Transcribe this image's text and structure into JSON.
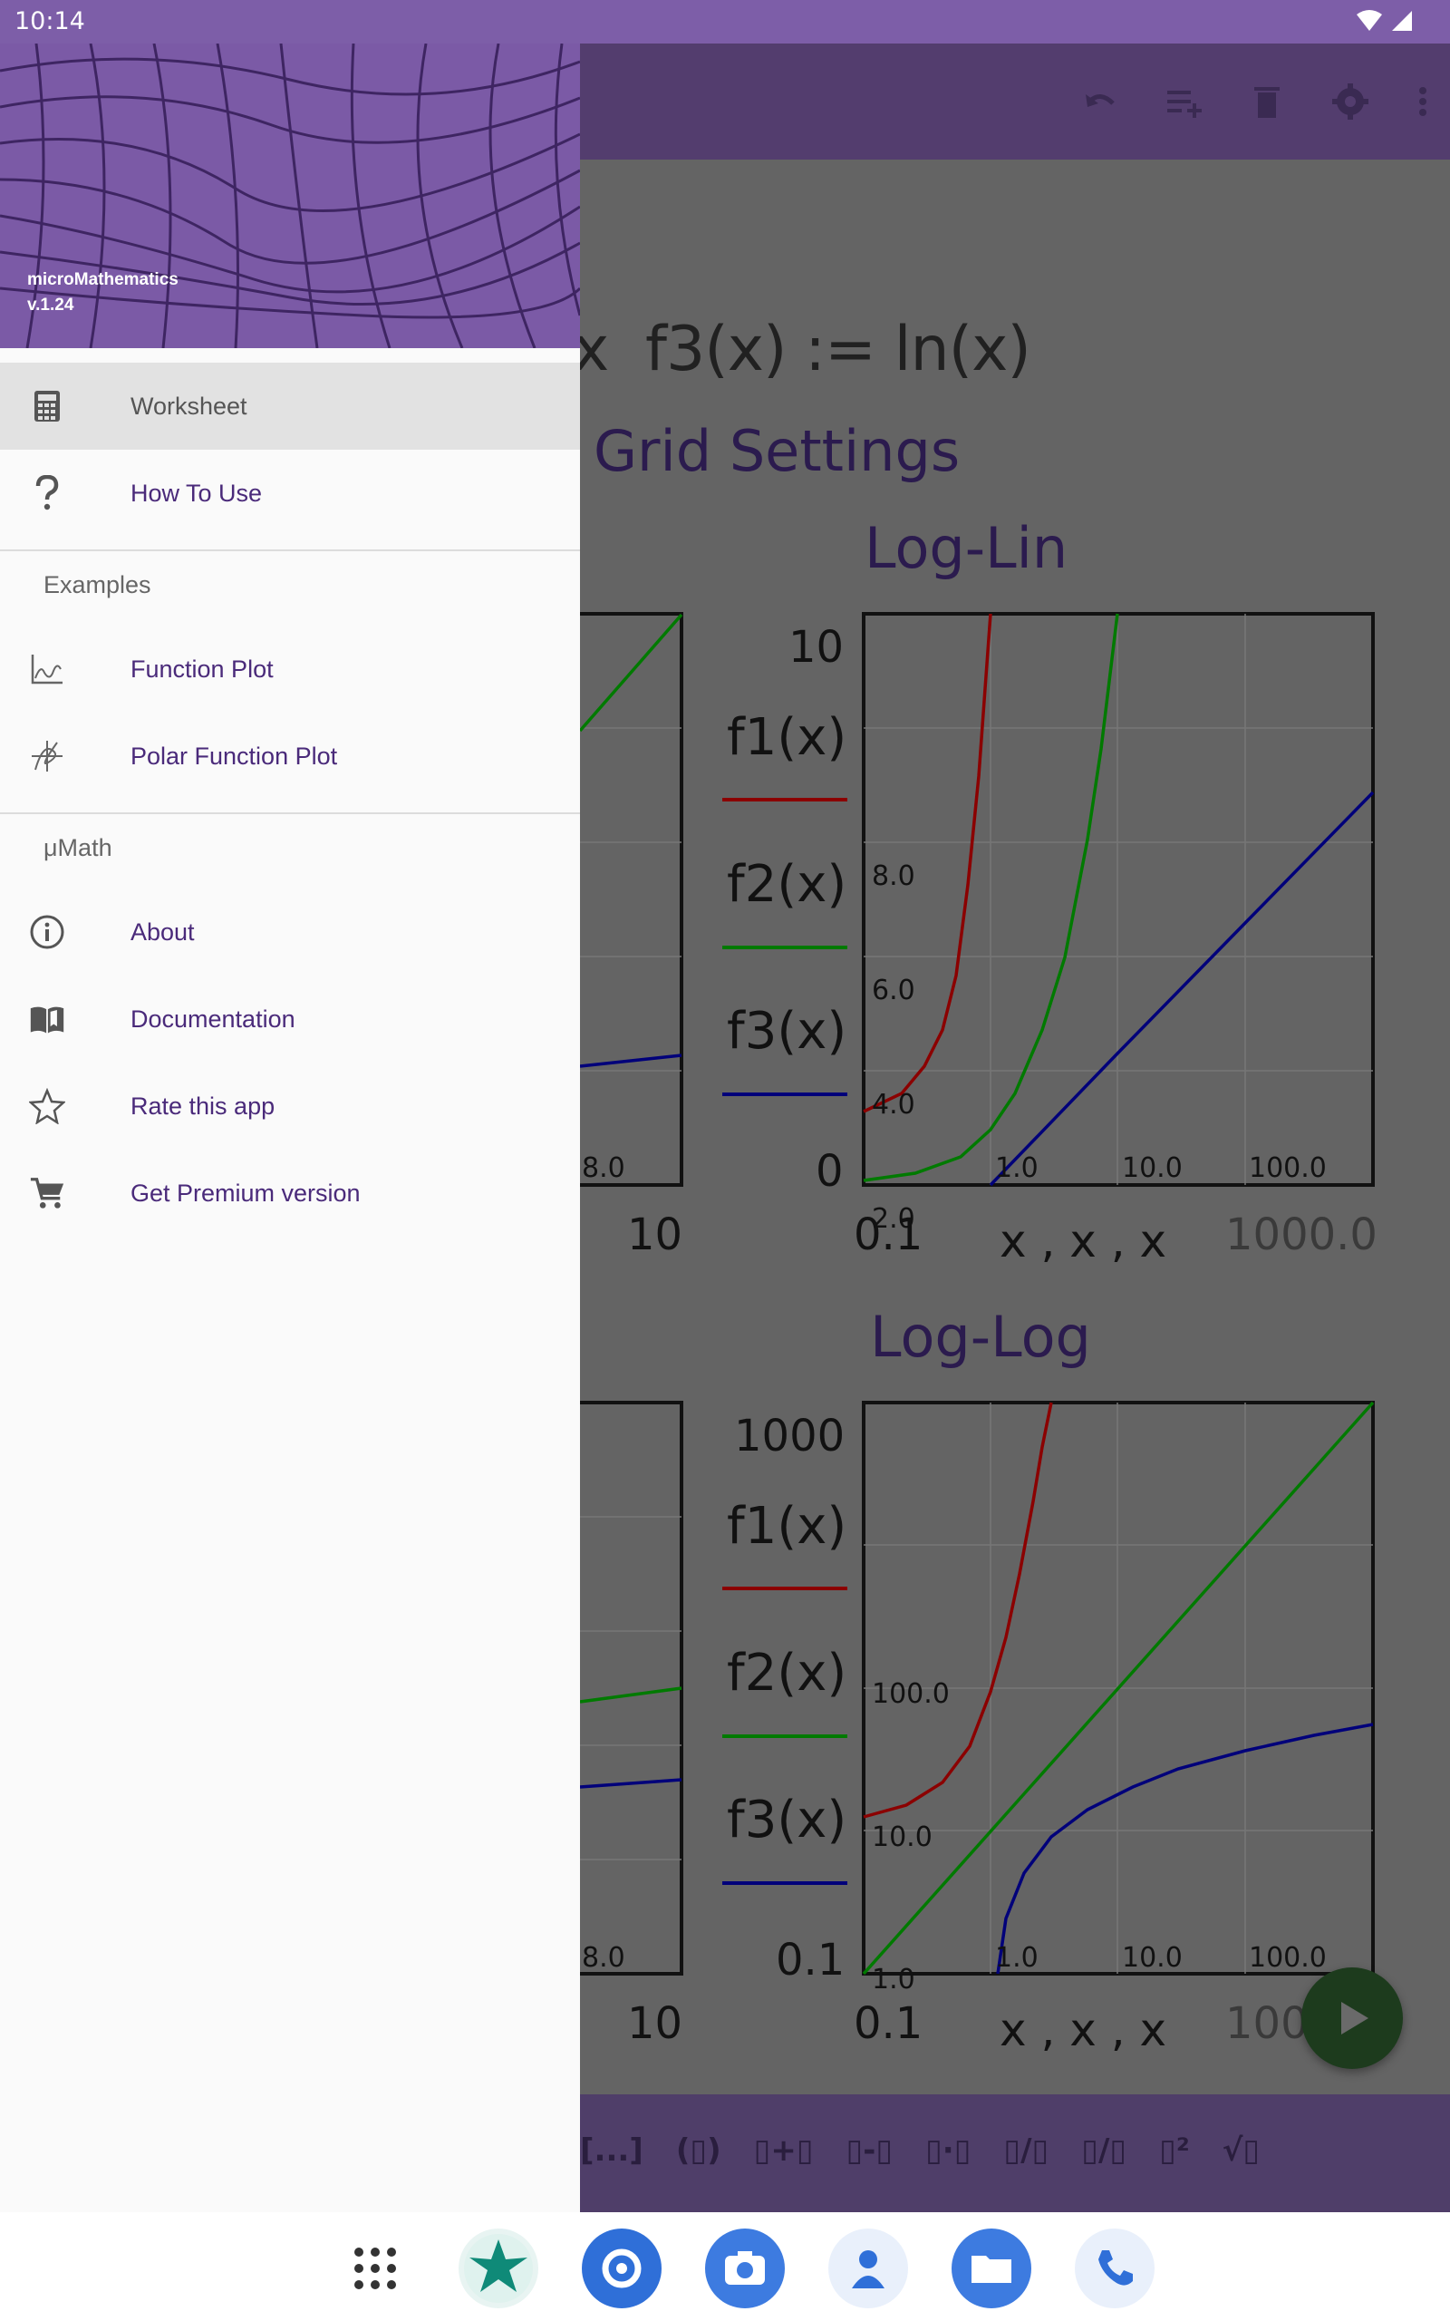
{
  "status": {
    "time": "10:14"
  },
  "worksheet": {
    "formula_prefix": "x",
    "formula": "f3(x) := ln(x)",
    "section_title": "Grid Settings",
    "plots": [
      {
        "title": "Log-Lin",
        "y_top": "10",
        "y_bottom": "0",
        "x_left": "0.1",
        "x_right": "1000.0",
        "x_label": "x , x , x",
        "y_ticks": [
          "8.0",
          "6.0",
          "4.0",
          "2.0"
        ],
        "x_ticks": [
          "1.0",
          "10.0",
          "100.0"
        ],
        "legend": [
          "f1(x)",
          "f2(x)",
          "f3(x)"
        ],
        "left_fragment": {
          "tick": "8.0",
          "x_right": "10"
        }
      },
      {
        "title": "Log-Log",
        "y_top": "1000",
        "y_bottom": "0.1",
        "x_left": "0.1",
        "x_right": "100",
        "x_label": "x , x , x",
        "y_ticks": [
          "100.0",
          "10.0",
          "1.0"
        ],
        "x_ticks": [
          "1.0",
          "10.0",
          "100.0"
        ],
        "legend": [
          "f1(x)",
          "f2(x)",
          "f3(x)"
        ],
        "left_fragment": {
          "tick": "8.0",
          "x_right": "10"
        }
      }
    ],
    "series_colors": {
      "f1": "#8b0000",
      "f2": "#007a00",
      "f3": "#00007a"
    }
  },
  "chart_data": [
    {
      "type": "line",
      "title": "Log-Lin",
      "xlabel": "x , x , x",
      "ylabel": "",
      "xlim": [
        0.1,
        1000.0
      ],
      "ylim": [
        0,
        10
      ],
      "x_scale": "log",
      "y_scale": "linear",
      "series": [
        {
          "name": "f1(x)",
          "x": [
            0.1,
            0.2,
            0.4,
            0.6,
            0.8,
            1.0,
            1.4
          ],
          "y": [
            1.1,
            1.5,
            2.2,
            3.2,
            5.0,
            7.4,
            10
          ]
        },
        {
          "name": "f2(x)",
          "x": [
            0.1,
            0.5,
            1.0,
            2.0,
            3.0,
            5.0,
            10.0
          ],
          "y": [
            0.1,
            0.5,
            1.0,
            2.0,
            3.0,
            5.0,
            10.0
          ]
        },
        {
          "name": "f3(x)",
          "x": [
            1.0,
            10.0,
            100.0,
            1000.0
          ],
          "y": [
            0.0,
            2.3,
            4.6,
            6.9
          ]
        }
      ]
    },
    {
      "type": "line",
      "title": "Log-Log",
      "xlabel": "x , x , x",
      "ylabel": "",
      "xlim": [
        0.1,
        1000.0
      ],
      "ylim": [
        0.1,
        1000
      ],
      "x_scale": "log",
      "y_scale": "log",
      "series": [
        {
          "name": "f1(x)",
          "x": [
            0.1,
            1.0,
            2.0,
            4.0,
            6.9
          ],
          "y": [
            1.1,
            2.7,
            7.4,
            54.6,
            1000
          ]
        },
        {
          "name": "f2(x)",
          "x": [
            0.1,
            1.0,
            10.0,
            100.0,
            1000.0
          ],
          "y": [
            0.1,
            1.0,
            10.0,
            100.0,
            1000.0
          ]
        },
        {
          "name": "f3(x)",
          "x": [
            1.1,
            2.0,
            10.0,
            100.0,
            1000.0
          ],
          "y": [
            0.1,
            0.69,
            2.3,
            4.6,
            6.9
          ]
        }
      ]
    }
  ],
  "palette": {
    "items": [
      "[...]",
      "(▯)",
      "▯+▯",
      "▯-▯",
      "▯·▯",
      "▯/▯",
      "▯/▯",
      "▯²",
      "√▯"
    ]
  },
  "drawer": {
    "app_name": "microMathematics",
    "version": "v.1.24",
    "items": [
      {
        "label": "Worksheet",
        "icon": "calculator-icon"
      },
      {
        "label": "How To Use",
        "icon": "question-mark-icon"
      }
    ],
    "examples_header": "Examples",
    "examples": [
      {
        "label": "Function Plot",
        "icon": "function-plot-icon"
      },
      {
        "label": "Polar Function Plot",
        "icon": "polar-plot-icon"
      }
    ],
    "umath_header": "μMath",
    "umath": [
      {
        "label": "About",
        "icon": "info-icon"
      },
      {
        "label": "Documentation",
        "icon": "book-icon"
      },
      {
        "label": "Rate this app",
        "icon": "star-icon"
      },
      {
        "label": "Get Premium version",
        "icon": "cart-icon"
      }
    ]
  },
  "colors": {
    "accent": "#7b5aa6",
    "status_bar": "#7d5ea8",
    "drawer_bg": "#fafafa"
  }
}
